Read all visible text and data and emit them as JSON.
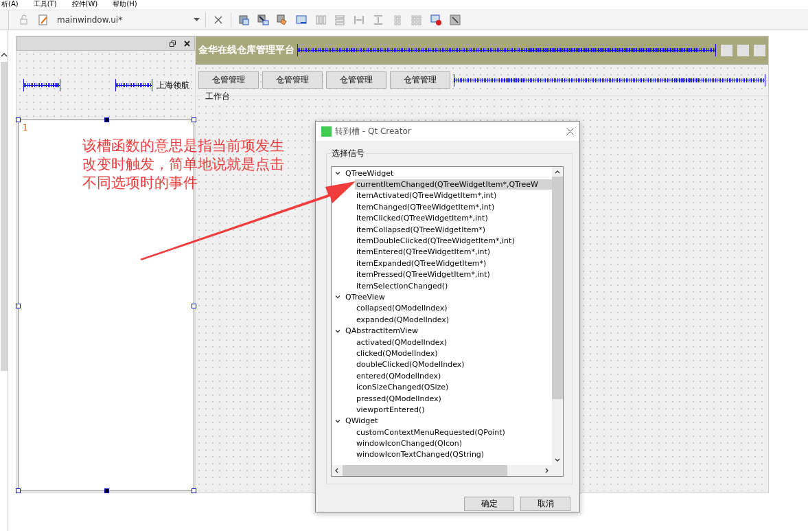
{
  "menu": [
    {
      "label": "析(A)"
    },
    {
      "label": "工具(T)"
    },
    {
      "label": "控件(W)"
    },
    {
      "label": "帮助(H)"
    }
  ],
  "toolbar": {
    "file": "mainwindow.ui*"
  },
  "dock": {
    "label": "上海领航",
    "list_items": [
      "1"
    ]
  },
  "form": {
    "title": "金华在线仓库管理平台",
    "buttons": [
      "仓管管理",
      "仓管管理",
      "仓管管理",
      "仓管管理"
    ],
    "group_title": "工作台"
  },
  "annotation": "该槽函数的意思是指当前项发生改变时触发，简单地说就是点击不同选项时的事件",
  "dialog": {
    "title": "转到槽 - Qt Creator",
    "group_title": "选择信号",
    "tree": [
      {
        "label": "QTreeWidget",
        "expanded": true,
        "children": [
          {
            "label": "currentItemChanged(QTreeWidgetItem*,QTreeW",
            "selected": true
          },
          {
            "label": "itemActivated(QTreeWidgetItem*,int)",
            "selected": false
          },
          {
            "label": "itemChanged(QTreeWidgetItem*,int)",
            "selected": false
          },
          {
            "label": "itemClicked(QTreeWidgetItem*,int)",
            "selected": false
          },
          {
            "label": "itemCollapsed(QTreeWidgetItem*)",
            "selected": false
          },
          {
            "label": "itemDoubleClicked(QTreeWidgetItem*,int)",
            "selected": false
          },
          {
            "label": "itemEntered(QTreeWidgetItem*,int)",
            "selected": false
          },
          {
            "label": "itemExpanded(QTreeWidgetItem*)",
            "selected": false
          },
          {
            "label": "itemPressed(QTreeWidgetItem*,int)",
            "selected": false
          },
          {
            "label": "itemSelectionChanged()",
            "selected": false
          }
        ]
      },
      {
        "label": "QTreeView",
        "expanded": true,
        "children": [
          {
            "label": "collapsed(QModelIndex)",
            "selected": false
          },
          {
            "label": "expanded(QModelIndex)",
            "selected": false
          }
        ]
      },
      {
        "label": "QAbstractItemView",
        "expanded": true,
        "children": [
          {
            "label": "activated(QModelIndex)",
            "selected": false
          },
          {
            "label": "clicked(QModelIndex)",
            "selected": false
          },
          {
            "label": "doubleClicked(QModelIndex)",
            "selected": false
          },
          {
            "label": "entered(QModelIndex)",
            "selected": false
          },
          {
            "label": "iconSizeChanged(QSize)",
            "selected": false
          },
          {
            "label": "pressed(QModelIndex)",
            "selected": false
          },
          {
            "label": "viewportEntered()",
            "selected": false
          }
        ]
      },
      {
        "label": "QWidget",
        "expanded": true,
        "children": [
          {
            "label": "customContextMenuRequested(QPoint)",
            "selected": false
          },
          {
            "label": "windowIconChanged(QIcon)",
            "selected": false
          },
          {
            "label": "windowIconTextChanged(QString)",
            "selected": false
          }
        ]
      }
    ],
    "buttons": [
      "确定",
      "取消"
    ]
  }
}
